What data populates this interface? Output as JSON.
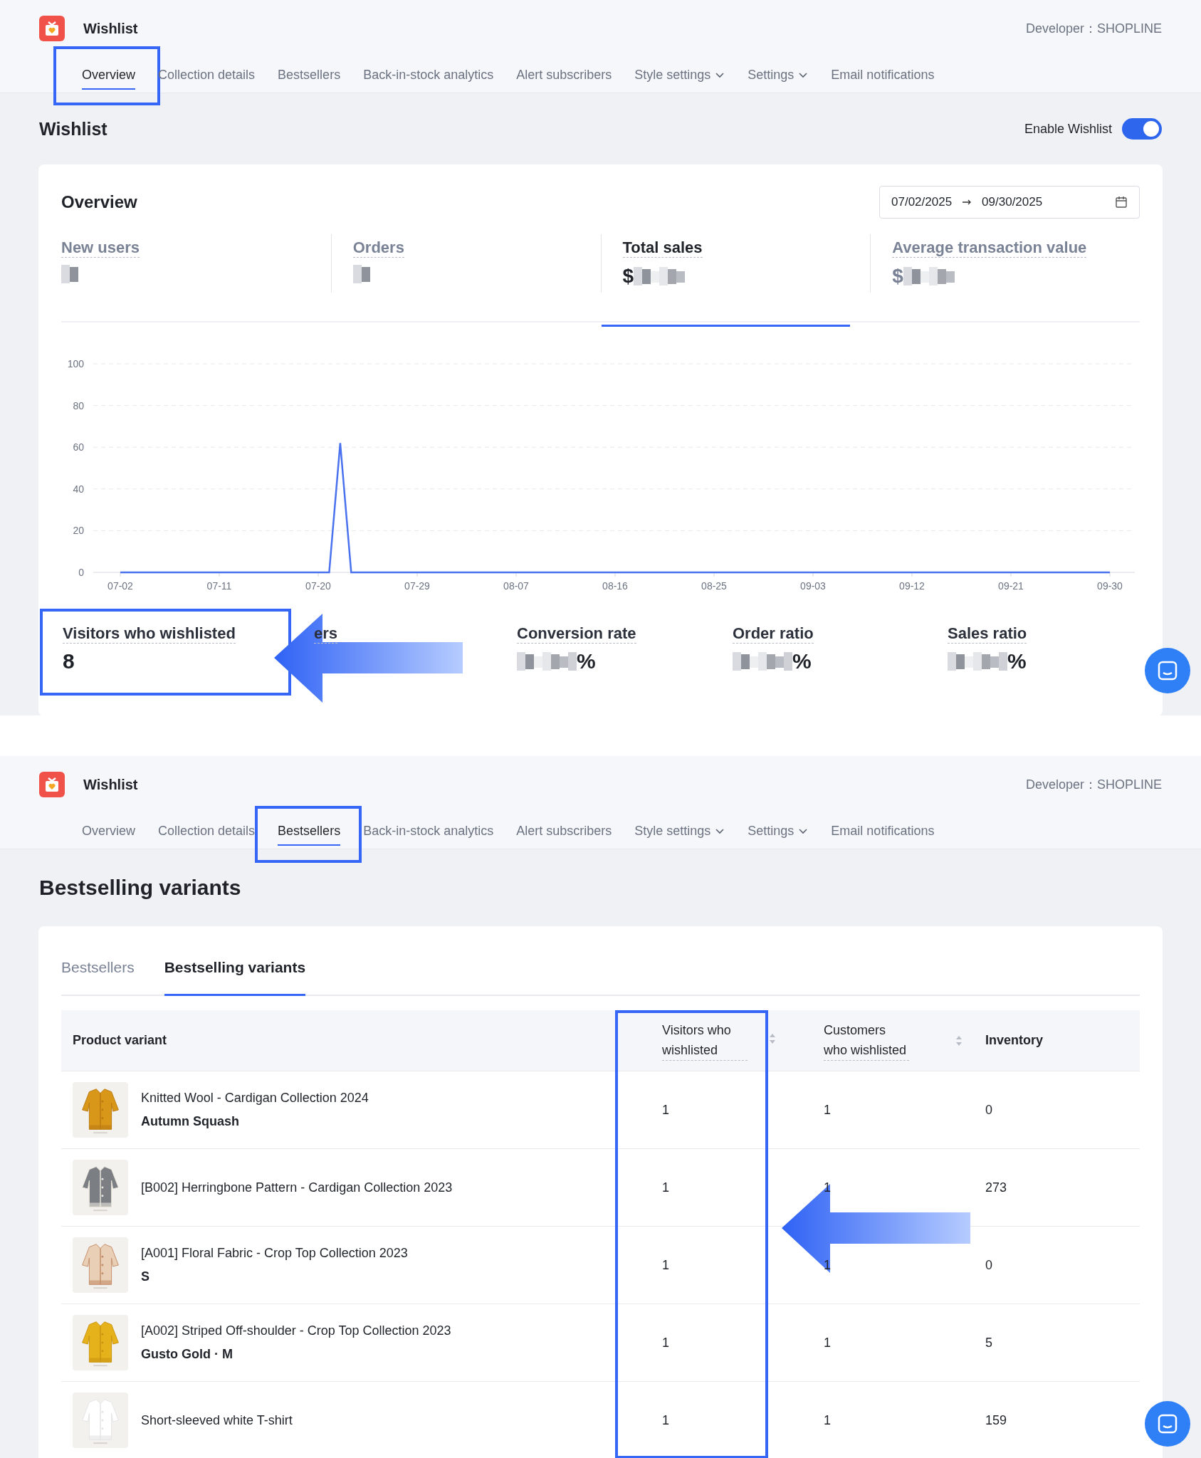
{
  "screens": [
    {
      "app": {
        "name": "Wishlist",
        "developer": "Developer：SHOPLINE"
      },
      "nav": [
        {
          "label": "Overview",
          "selected": true,
          "highlighted": true,
          "dropdown": false
        },
        {
          "label": "Collection details",
          "selected": false,
          "highlighted": false,
          "dropdown": false
        },
        {
          "label": "Bestsellers",
          "selected": false,
          "highlighted": false,
          "dropdown": false
        },
        {
          "label": "Back-in-stock analytics",
          "selected": false,
          "highlighted": false,
          "dropdown": false
        },
        {
          "label": "Alert subscribers",
          "selected": false,
          "highlighted": false,
          "dropdown": false
        },
        {
          "label": "Style settings",
          "selected": false,
          "highlighted": false,
          "dropdown": true
        },
        {
          "label": "Settings",
          "selected": false,
          "highlighted": false,
          "dropdown": true
        },
        {
          "label": "Email notifications",
          "selected": false,
          "highlighted": false,
          "dropdown": false
        }
      ],
      "kind": "overview",
      "page_title": "Wishlist",
      "toggle": {
        "label": "Enable Wishlist",
        "on": true
      },
      "card": {
        "title": "Overview",
        "date_start": "07/02/2025",
        "date_end": "09/30/2025",
        "stats": [
          {
            "label": "New users",
            "selected": false
          },
          {
            "label": "Orders",
            "selected": false
          },
          {
            "label": "Total sales",
            "selected": true,
            "prefix": "$"
          },
          {
            "label": "Average transaction value",
            "selected": false,
            "prefix": "$"
          }
        ],
        "chart_data": {
          "type": "line",
          "grid": true,
          "ylim": [
            0,
            100
          ],
          "yticks": [
            0,
            20,
            40,
            60,
            80,
            100
          ],
          "categories": [
            "07-02",
            null,
            null,
            null,
            null,
            null,
            null,
            null,
            null,
            "07-11",
            null,
            null,
            null,
            null,
            null,
            null,
            null,
            null,
            "07-20",
            null,
            null,
            null,
            null,
            null,
            null,
            null,
            null,
            "07-29",
            null,
            null,
            null,
            null,
            null,
            null,
            null,
            null,
            "08-07",
            null,
            null,
            null,
            null,
            null,
            null,
            null,
            null,
            "08-16",
            null,
            null,
            null,
            null,
            null,
            null,
            null,
            null,
            "08-25",
            null,
            null,
            null,
            null,
            null,
            null,
            null,
            null,
            "09-03",
            null,
            null,
            null,
            null,
            null,
            null,
            null,
            null,
            "09-12",
            null,
            null,
            null,
            null,
            null,
            null,
            null,
            null,
            "09-21",
            null,
            null,
            null,
            null,
            null,
            null,
            null,
            null,
            "09-30"
          ],
          "series": [
            {
              "color": "#4a72ee",
              "values": [
                0,
                0,
                0,
                0,
                0,
                0,
                0,
                0,
                0,
                0,
                0,
                0,
                0,
                0,
                0,
                0,
                0,
                0,
                0,
                0,
                62,
                0,
                0,
                0,
                0,
                0,
                0,
                0,
                0,
                0,
                0,
                0,
                0,
                0,
                0,
                0,
                0,
                0,
                0,
                0,
                0,
                0,
                0,
                0,
                0,
                0,
                0,
                0,
                0,
                0,
                0,
                0,
                0,
                0,
                0,
                0,
                0,
                0,
                0,
                0,
                0,
                0,
                0,
                0,
                0,
                0,
                0,
                0,
                0,
                0,
                0,
                0,
                0,
                0,
                0,
                0,
                0,
                0,
                0,
                0,
                0,
                0,
                0,
                0,
                0,
                0,
                0,
                0,
                0,
                0,
                0
              ]
            }
          ]
        },
        "metrics": [
          {
            "label": "Visitors who wishlisted",
            "kind": "plain",
            "value": "8",
            "highlighted": true
          },
          {
            "label": "ers",
            "kind": "covered",
            "highlighted": false
          },
          {
            "label": "Conversion rate",
            "kind": "blurred",
            "suffix": "%",
            "highlighted": false
          },
          {
            "label": "Order ratio",
            "kind": "blurred",
            "suffix": "%",
            "highlighted": false
          },
          {
            "label": "Sales ratio",
            "kind": "blurred",
            "suffix": "%",
            "highlighted": false
          }
        ]
      }
    },
    {
      "app": {
        "name": "Wishlist",
        "developer": "Developer：SHOPLINE"
      },
      "nav": [
        {
          "label": "Overview",
          "selected": false,
          "highlighted": false,
          "dropdown": false
        },
        {
          "label": "Collection details",
          "selected": false,
          "highlighted": false,
          "dropdown": false
        },
        {
          "label": "Bestsellers",
          "selected": true,
          "highlighted": true,
          "dropdown": false
        },
        {
          "label": "Back-in-stock analytics",
          "selected": false,
          "highlighted": false,
          "dropdown": false
        },
        {
          "label": "Alert subscribers",
          "selected": false,
          "highlighted": false,
          "dropdown": false
        },
        {
          "label": "Style settings",
          "selected": false,
          "highlighted": false,
          "dropdown": true
        },
        {
          "label": "Settings",
          "selected": false,
          "highlighted": false,
          "dropdown": true
        },
        {
          "label": "Email notifications",
          "selected": false,
          "highlighted": false,
          "dropdown": false
        }
      ],
      "kind": "bestsellers",
      "page_title": "Bestselling variants",
      "card": {
        "tabs": [
          {
            "label": "Bestsellers",
            "selected": false
          },
          {
            "label": "Bestselling variants",
            "selected": true
          }
        ],
        "columns": [
          {
            "label": "Product variant",
            "sortable": false,
            "highlighted": false,
            "dotted": false
          },
          {
            "label": "Visitors who wishlisted",
            "sortable": true,
            "highlighted": true,
            "dotted": true
          },
          {
            "label": "Customers who wishlisted",
            "sortable": true,
            "highlighted": false,
            "dotted": true
          },
          {
            "label": "Inventory",
            "sortable": false,
            "highlighted": false,
            "dotted": false
          }
        ],
        "rows": [
          {
            "product": "Knitted Wool - Cardigan Collection 2024",
            "variant": "Autumn Squash",
            "visitors": "1",
            "customers": "1",
            "inventory": "0"
          },
          {
            "product": "[B002] Herringbone Pattern - Cardigan Collection 2023",
            "visitors": "1",
            "customers": "1",
            "inventory": "273"
          },
          {
            "product": "[A001] Floral Fabric - Crop Top Collection 2023",
            "variant": "S",
            "visitors": "1",
            "customers": "1",
            "inventory": "0"
          },
          {
            "product": "[A002] Striped Off-shoulder - Crop Top Collection 2023",
            "variant": "Gusto Gold · M",
            "visitors": "1",
            "customers": "1",
            "inventory": "5"
          },
          {
            "product": "Short-sleeved white T-shirt",
            "visitors": "1",
            "customers": "1",
            "inventory": "159"
          }
        ]
      }
    }
  ]
}
